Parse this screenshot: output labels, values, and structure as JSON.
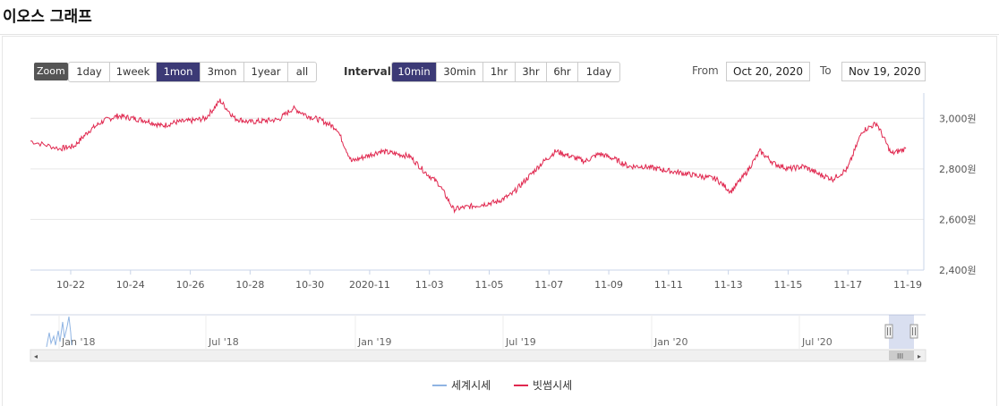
{
  "header": {
    "title": "이오스 그래프"
  },
  "zoom": {
    "label": "Zoom",
    "buttons": [
      "1day",
      "1week",
      "1mon",
      "3mon",
      "1year",
      "all"
    ],
    "active": "1mon"
  },
  "interval": {
    "label": "Interval",
    "buttons": [
      "10min",
      "30min",
      "1hr",
      "3hr",
      "6hr",
      "1day"
    ],
    "active": "10min"
  },
  "range": {
    "from_label": "From",
    "from_value": "Oct 20, 2020",
    "to_label": "To",
    "to_value": "Nov 19, 2020"
  },
  "chart_data": {
    "type": "line",
    "title": "",
    "x_start": "2020-10-20",
    "x_end": "2020-11-19",
    "xtick_labels": [
      "10-22",
      "10-24",
      "10-26",
      "10-28",
      "10-30",
      "2020-11",
      "11-03",
      "11-05",
      "11-07",
      "11-09",
      "11-11",
      "11-13",
      "11-15",
      "11-17",
      "11-19"
    ],
    "ylim": [
      2400,
      3100
    ],
    "yticks": [
      2400,
      2600,
      2800,
      3000
    ],
    "ytick_labels": [
      "2,400원",
      "2,600원",
      "2,800원",
      "3,000원"
    ],
    "grid": true,
    "legend_position": "bottom-center",
    "series": [
      {
        "name": "세계시세",
        "color": "#8fb4e3",
        "x": [],
        "y": []
      },
      {
        "name": "빗썸시세",
        "color": "#e0284f",
        "x": [
          "2020-10-20",
          "2020-10-21",
          "2020-10-21T12",
          "2020-10-22",
          "2020-10-22T12",
          "2020-10-23",
          "2020-10-23T12",
          "2020-10-24",
          "2020-10-24T12",
          "2020-10-25",
          "2020-10-25T12",
          "2020-10-26",
          "2020-10-26T12",
          "2020-10-27",
          "2020-10-27T12",
          "2020-10-28",
          "2020-10-28T12",
          "2020-10-29",
          "2020-10-29T12",
          "2020-10-30",
          "2020-10-30T12",
          "2020-10-31",
          "2020-10-31T12",
          "2020-11-01",
          "2020-11-01T12",
          "2020-11-02",
          "2020-11-02T12",
          "2020-11-03",
          "2020-11-03T12",
          "2020-11-04",
          "2020-11-04T12",
          "2020-11-05",
          "2020-11-05T12",
          "2020-11-06",
          "2020-11-06T12",
          "2020-11-07",
          "2020-11-07T12",
          "2020-11-08",
          "2020-11-08T12",
          "2020-11-09",
          "2020-11-09T12",
          "2020-11-10",
          "2020-11-10T12",
          "2020-11-11",
          "2020-11-11T12",
          "2020-11-12",
          "2020-11-12T12",
          "2020-11-13",
          "2020-11-13T12",
          "2020-11-14",
          "2020-11-14T12",
          "2020-11-15",
          "2020-11-15T12",
          "2020-11-16",
          "2020-11-16T12",
          "2020-11-17",
          "2020-11-17T12",
          "2020-11-18",
          "2020-11-18T12",
          "2020-11-19"
        ],
        "y": [
          2910,
          2880,
          2890,
          2950,
          2990,
          3010,
          3000,
          2990,
          2970,
          2985,
          2990,
          3000,
          3070,
          3000,
          2985,
          2990,
          2995,
          3040,
          3010,
          2990,
          2960,
          2830,
          2850,
          2870,
          2860,
          2850,
          2790,
          2740,
          2640,
          2650,
          2660,
          2670,
          2700,
          2760,
          2820,
          2870,
          2850,
          2830,
          2860,
          2840,
          2810,
          2810,
          2800,
          2790,
          2780,
          2770,
          2760,
          2710,
          2780,
          2870,
          2820,
          2800,
          2810,
          2780,
          2760,
          2800,
          2950,
          2980,
          2860,
          2880
        ]
      }
    ],
    "navigator": {
      "xtick_labels": [
        "Jan '18",
        "Jul '18",
        "Jan '19",
        "Jul '19",
        "Jan '20",
        "Jul '20"
      ]
    }
  }
}
